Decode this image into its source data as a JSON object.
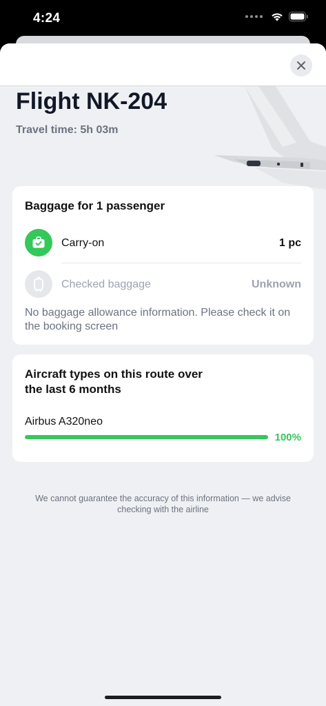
{
  "status_bar": {
    "time": "4:24"
  },
  "header": {
    "close_icon": "close-icon"
  },
  "flight": {
    "title": "Flight NK-204",
    "travel_time": "Travel time: 5h 03m"
  },
  "baggage": {
    "title": "Baggage for 1 passenger",
    "items": [
      {
        "label": "Carry-on",
        "value": "1 pc",
        "icon": "carry-on-bag-icon",
        "status": "included"
      },
      {
        "label": "Checked baggage",
        "value": "Unknown",
        "icon": "checked-bag-icon",
        "status": "unknown"
      }
    ],
    "note": "No baggage allowance information. Please check it on the booking screen"
  },
  "aircraft": {
    "title": "Aircraft types on this route over the last 6 months",
    "types": [
      {
        "name": "Airbus A320neo",
        "share_percent": 100,
        "share_label": "100%"
      }
    ]
  },
  "disclaimer": "We cannot guarantee the accuracy of this information — we advise checking with the airline",
  "colors": {
    "accent_green": "#34c759",
    "muted_gray": "#9ca3af",
    "background": "#eff0f3"
  }
}
